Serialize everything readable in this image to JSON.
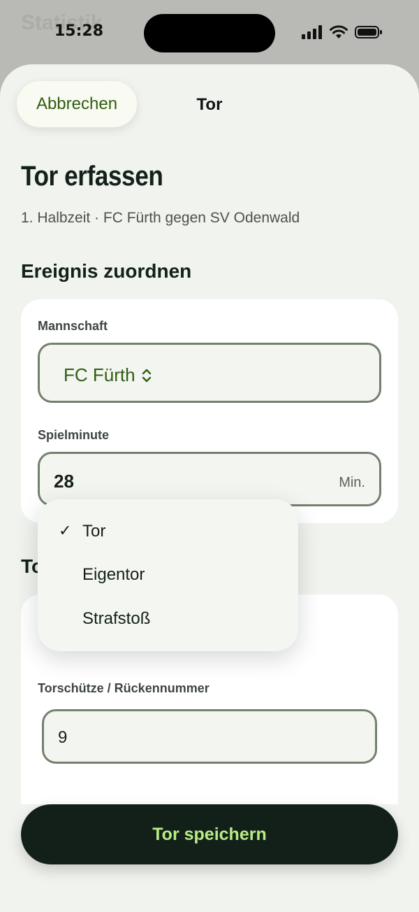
{
  "status": {
    "time": "15:28"
  },
  "background": {
    "title": "Statistik"
  },
  "header": {
    "cancel_label": "Abbrechen",
    "title": "Tor"
  },
  "page": {
    "title": "Tor erfassen",
    "subtitle": "1. Halbzeit · FC Fürth gegen SV Odenwald"
  },
  "assign": {
    "section_title": "Ereignis zuordnen",
    "team_label": "Mannschaft",
    "team_value": "FC Fürth",
    "minute_label": "Spielminute",
    "minute_value": "28",
    "minute_unit": "Min."
  },
  "goal": {
    "section_title": "To",
    "scorer_label": "Torschütze / Rückennummer",
    "scorer_value": "9"
  },
  "dropdown": {
    "items": [
      {
        "label": "Tor",
        "selected": true,
        "check": "✓"
      },
      {
        "label": "Eigentor",
        "selected": false,
        "check": ""
      },
      {
        "label": "Strafstoß",
        "selected": false,
        "check": ""
      }
    ]
  },
  "footer": {
    "save_label": "Tor speichern"
  },
  "colors": {
    "accent": "#2f5d12",
    "button_bg": "#13201a",
    "button_text": "#b9ec86",
    "sheet_bg": "#f1f3ee"
  },
  "icons": {
    "team_select": "chevron-up-down-icon",
    "check": "checkmark-icon",
    "signal": "cellular-signal-icon",
    "wifi": "wifi-icon",
    "battery": "battery-icon"
  }
}
